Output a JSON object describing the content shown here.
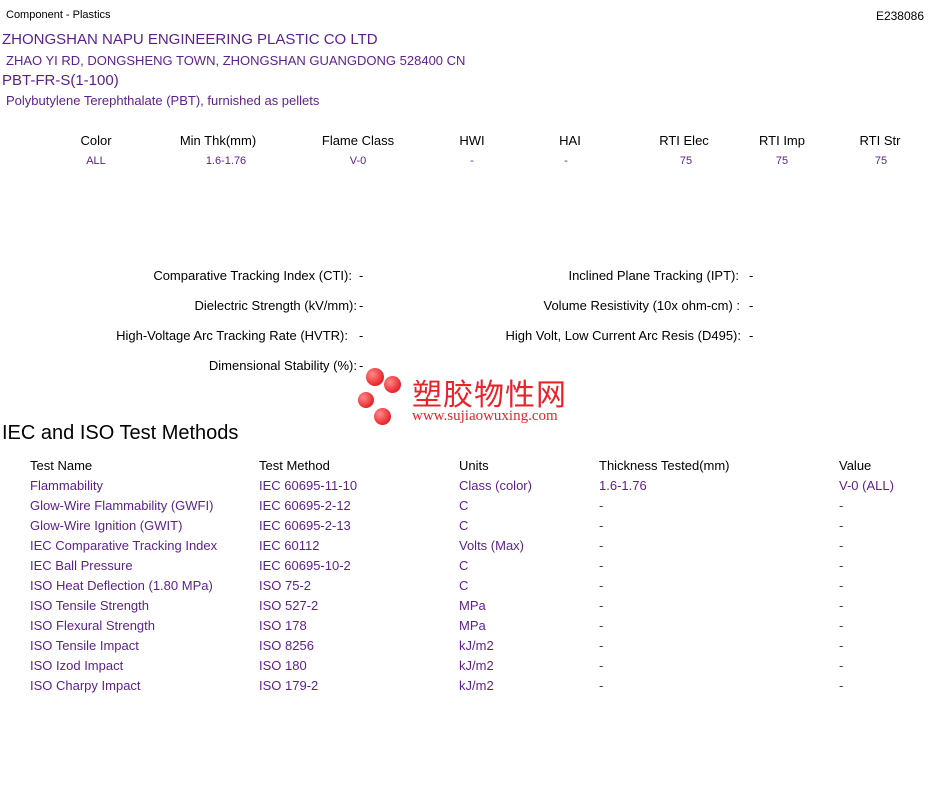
{
  "header": {
    "category": "Component - Plastics",
    "file_number": "E238086"
  },
  "company": {
    "name": "ZHONGSHAN NAPU ENGINEERING PLASTIC CO LTD",
    "address": "ZHAO YI RD, DONGSHENG TOWN, ZHONGSHAN  GUANGDONG  528400 CN"
  },
  "product": {
    "grade": "PBT-FR-S(1-100)",
    "description": "Polybutylene Terephthalate (PBT), furnished as pellets"
  },
  "properties": {
    "headers": [
      "Color",
      "Min Thk(mm)",
      "Flame Class",
      "HWI",
      "HAI",
      "RTI Elec",
      "RTI Imp",
      "RTI Str"
    ],
    "values": [
      "ALL",
      "1.6-1.76",
      "V-0",
      "-",
      "-",
      "75",
      "75",
      "75"
    ]
  },
  "electrical": {
    "cti_label": "Comparative Tracking Index (CTI):",
    "cti_value": "-",
    "ds_label": "Dielectric Strength (kV/mm):",
    "ds_value": "-",
    "hvtr_label": "High-Voltage Arc Tracking Rate (HVTR):",
    "hvtr_value": "-",
    "dim_label": "Dimensional Stability (%):",
    "dim_value": "-",
    "ipt_label": "Inclined Plane Tracking (IPT):",
    "ipt_value": "-",
    "vr_label": "Volume Resistivity (10x ohm-cm) :",
    "vr_value": "-",
    "d495_label": "High Volt, Low Current Arc Resis (D495):",
    "d495_value": "-"
  },
  "watermark": {
    "chinese": "塑胶物性网",
    "url": "www.sujiaowuxing.com"
  },
  "iec": {
    "title": "IEC and ISO Test Methods",
    "headers": [
      "Test Name",
      "Test Method",
      "Units",
      "Thickness Tested(mm)",
      "Value"
    ],
    "rows": [
      [
        "Flammability",
        "IEC 60695-11-10",
        "Class (color)",
        "1.6-1.76",
        "V-0 (ALL)"
      ],
      [
        "Glow-Wire Flammability (GWFI)",
        "IEC 60695-2-12",
        "C",
        "-",
        "-"
      ],
      [
        "Glow-Wire Ignition (GWIT)",
        "IEC 60695-2-13",
        "C",
        "-",
        "-"
      ],
      [
        "IEC Comparative Tracking Index",
        "IEC 60112",
        "Volts (Max)",
        "-",
        "-"
      ],
      [
        "IEC Ball Pressure",
        "IEC 60695-10-2",
        "C",
        "-",
        "-"
      ],
      [
        "ISO Heat Deflection (1.80 MPa)",
        "ISO 75-2",
        "C",
        "-",
        "-"
      ],
      [
        "ISO Tensile Strength",
        "ISO 527-2",
        "MPa",
        "-",
        "-"
      ],
      [
        "ISO Flexural Strength",
        "ISO 178",
        "MPa",
        "-",
        "-"
      ],
      [
        "ISO Tensile Impact",
        "ISO 8256",
        "kJ/m2",
        "-",
        "-"
      ],
      [
        "ISO Izod Impact",
        "ISO 180",
        "kJ/m2",
        "-",
        "-"
      ],
      [
        "ISO Charpy Impact",
        "ISO 179-2",
        "kJ/m2",
        "-",
        "-"
      ]
    ]
  }
}
